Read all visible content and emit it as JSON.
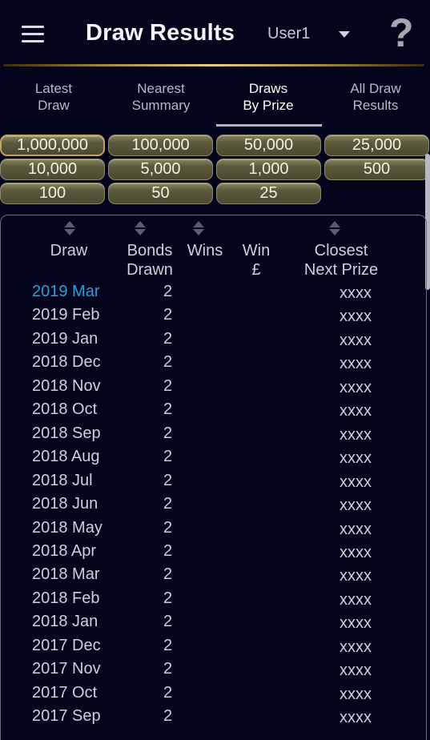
{
  "appbar": {
    "title": "Draw Results",
    "user": "User1",
    "menu_icon": "hamburger-menu-icon",
    "help_icon": "question-mark-icon",
    "help_glyph": "?"
  },
  "tabs": [
    {
      "line1": "Latest",
      "line2": "Draw",
      "active": false
    },
    {
      "line1": "Nearest",
      "line2": "Summary",
      "active": false
    },
    {
      "line1": "Draws",
      "line2": "By Prize",
      "active": true
    },
    {
      "line1": "All Draw",
      "line2": "Results",
      "active": false
    }
  ],
  "prizes": {
    "selected": "1,000,000",
    "values": [
      "1,000,000",
      "100,000",
      "50,000",
      "25,000",
      "10,000",
      "5,000",
      "1,000",
      "500",
      "100",
      "50",
      "25"
    ]
  },
  "table": {
    "headers": {
      "draw": "Draw",
      "bonds_1": "Bonds",
      "bonds_2": "Drawn",
      "wins": "Wins",
      "win_1": "Win",
      "win_2": "£",
      "closest_1": "Closest",
      "closest_2": "Next Prize"
    },
    "rows": [
      {
        "draw": "2019 Mar",
        "bonds": "2",
        "wins": "",
        "win": "",
        "closest": "xxxx"
      },
      {
        "draw": "2019 Feb",
        "bonds": "2",
        "wins": "",
        "win": "",
        "closest": "xxxx"
      },
      {
        "draw": "2019 Jan",
        "bonds": "2",
        "wins": "",
        "win": "",
        "closest": "xxxx"
      },
      {
        "draw": "2018 Dec",
        "bonds": "2",
        "wins": "",
        "win": "",
        "closest": "xxxx"
      },
      {
        "draw": "2018 Nov",
        "bonds": "2",
        "wins": "",
        "win": "",
        "closest": "xxxx"
      },
      {
        "draw": "2018 Oct",
        "bonds": "2",
        "wins": "",
        "win": "",
        "closest": "xxxx"
      },
      {
        "draw": "2018 Sep",
        "bonds": "2",
        "wins": "",
        "win": "",
        "closest": "xxxx"
      },
      {
        "draw": "2018 Aug",
        "bonds": "2",
        "wins": "",
        "win": "",
        "closest": "xxxx"
      },
      {
        "draw": "2018 Jul",
        "bonds": "2",
        "wins": "",
        "win": "",
        "closest": "xxxx"
      },
      {
        "draw": "2018 Jun",
        "bonds": "2",
        "wins": "",
        "win": "",
        "closest": "xxxx"
      },
      {
        "draw": "2018 May",
        "bonds": "2",
        "wins": "",
        "win": "",
        "closest": "xxxx"
      },
      {
        "draw": "2018 Apr",
        "bonds": "2",
        "wins": "",
        "win": "",
        "closest": "xxxx"
      },
      {
        "draw": "2018 Mar",
        "bonds": "2",
        "wins": "",
        "win": "",
        "closest": "xxxx"
      },
      {
        "draw": "2018 Feb",
        "bonds": "2",
        "wins": "",
        "win": "",
        "closest": "xxxx"
      },
      {
        "draw": "2018 Jan",
        "bonds": "2",
        "wins": "",
        "win": "",
        "closest": "xxxx"
      },
      {
        "draw": "2017 Dec",
        "bonds": "2",
        "wins": "",
        "win": "",
        "closest": "xxxx"
      },
      {
        "draw": "2017 Nov",
        "bonds": "2",
        "wins": "",
        "win": "",
        "closest": "xxxx"
      },
      {
        "draw": "2017 Oct",
        "bonds": "2",
        "wins": "",
        "win": "",
        "closest": "xxxx"
      },
      {
        "draw": "2017 Sep",
        "bonds": "2",
        "wins": "",
        "win": "",
        "closest": "xxxx"
      }
    ],
    "highlighted_row": "2019 Mar"
  },
  "colors": {
    "background": "#04041c",
    "accent_gold": "#c9a25a",
    "highlight_blue": "#2f9cde",
    "button_olive": "#5c5a3c"
  }
}
